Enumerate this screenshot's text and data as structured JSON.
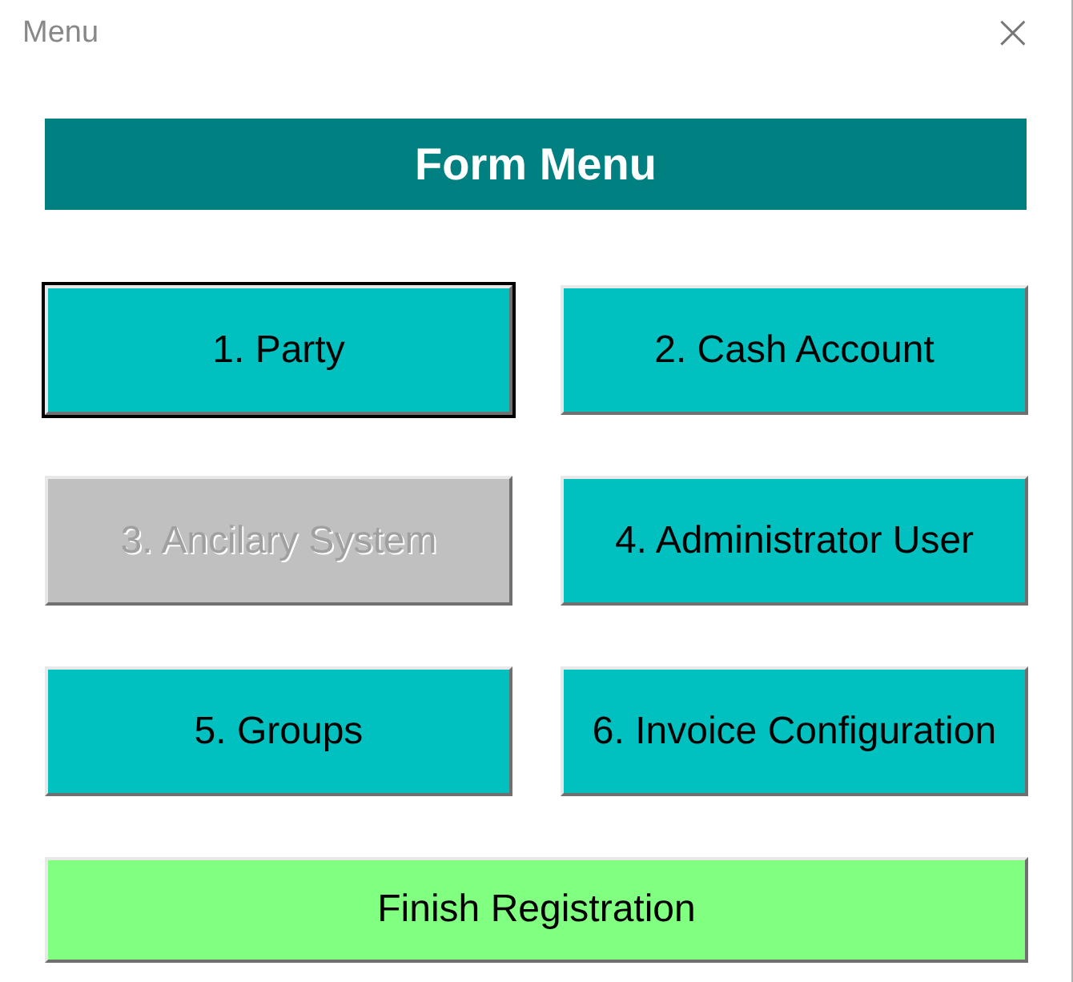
{
  "window": {
    "title": "Menu",
    "close": "×"
  },
  "header": "Form Menu",
  "buttons": [
    {
      "label": "1. Party",
      "disabled": false,
      "focused": true
    },
    {
      "label": "2. Cash Account",
      "disabled": false,
      "focused": false
    },
    {
      "label": "3. Ancilary System",
      "disabled": true,
      "focused": false
    },
    {
      "label": "4. Administrator User",
      "disabled": false,
      "focused": false
    },
    {
      "label": "5. Groups",
      "disabled": false,
      "focused": false
    },
    {
      "label": "6. Invoice Configuration",
      "disabled": false,
      "focused": false
    }
  ],
  "finish_button": {
    "label": "Finish Registration"
  }
}
